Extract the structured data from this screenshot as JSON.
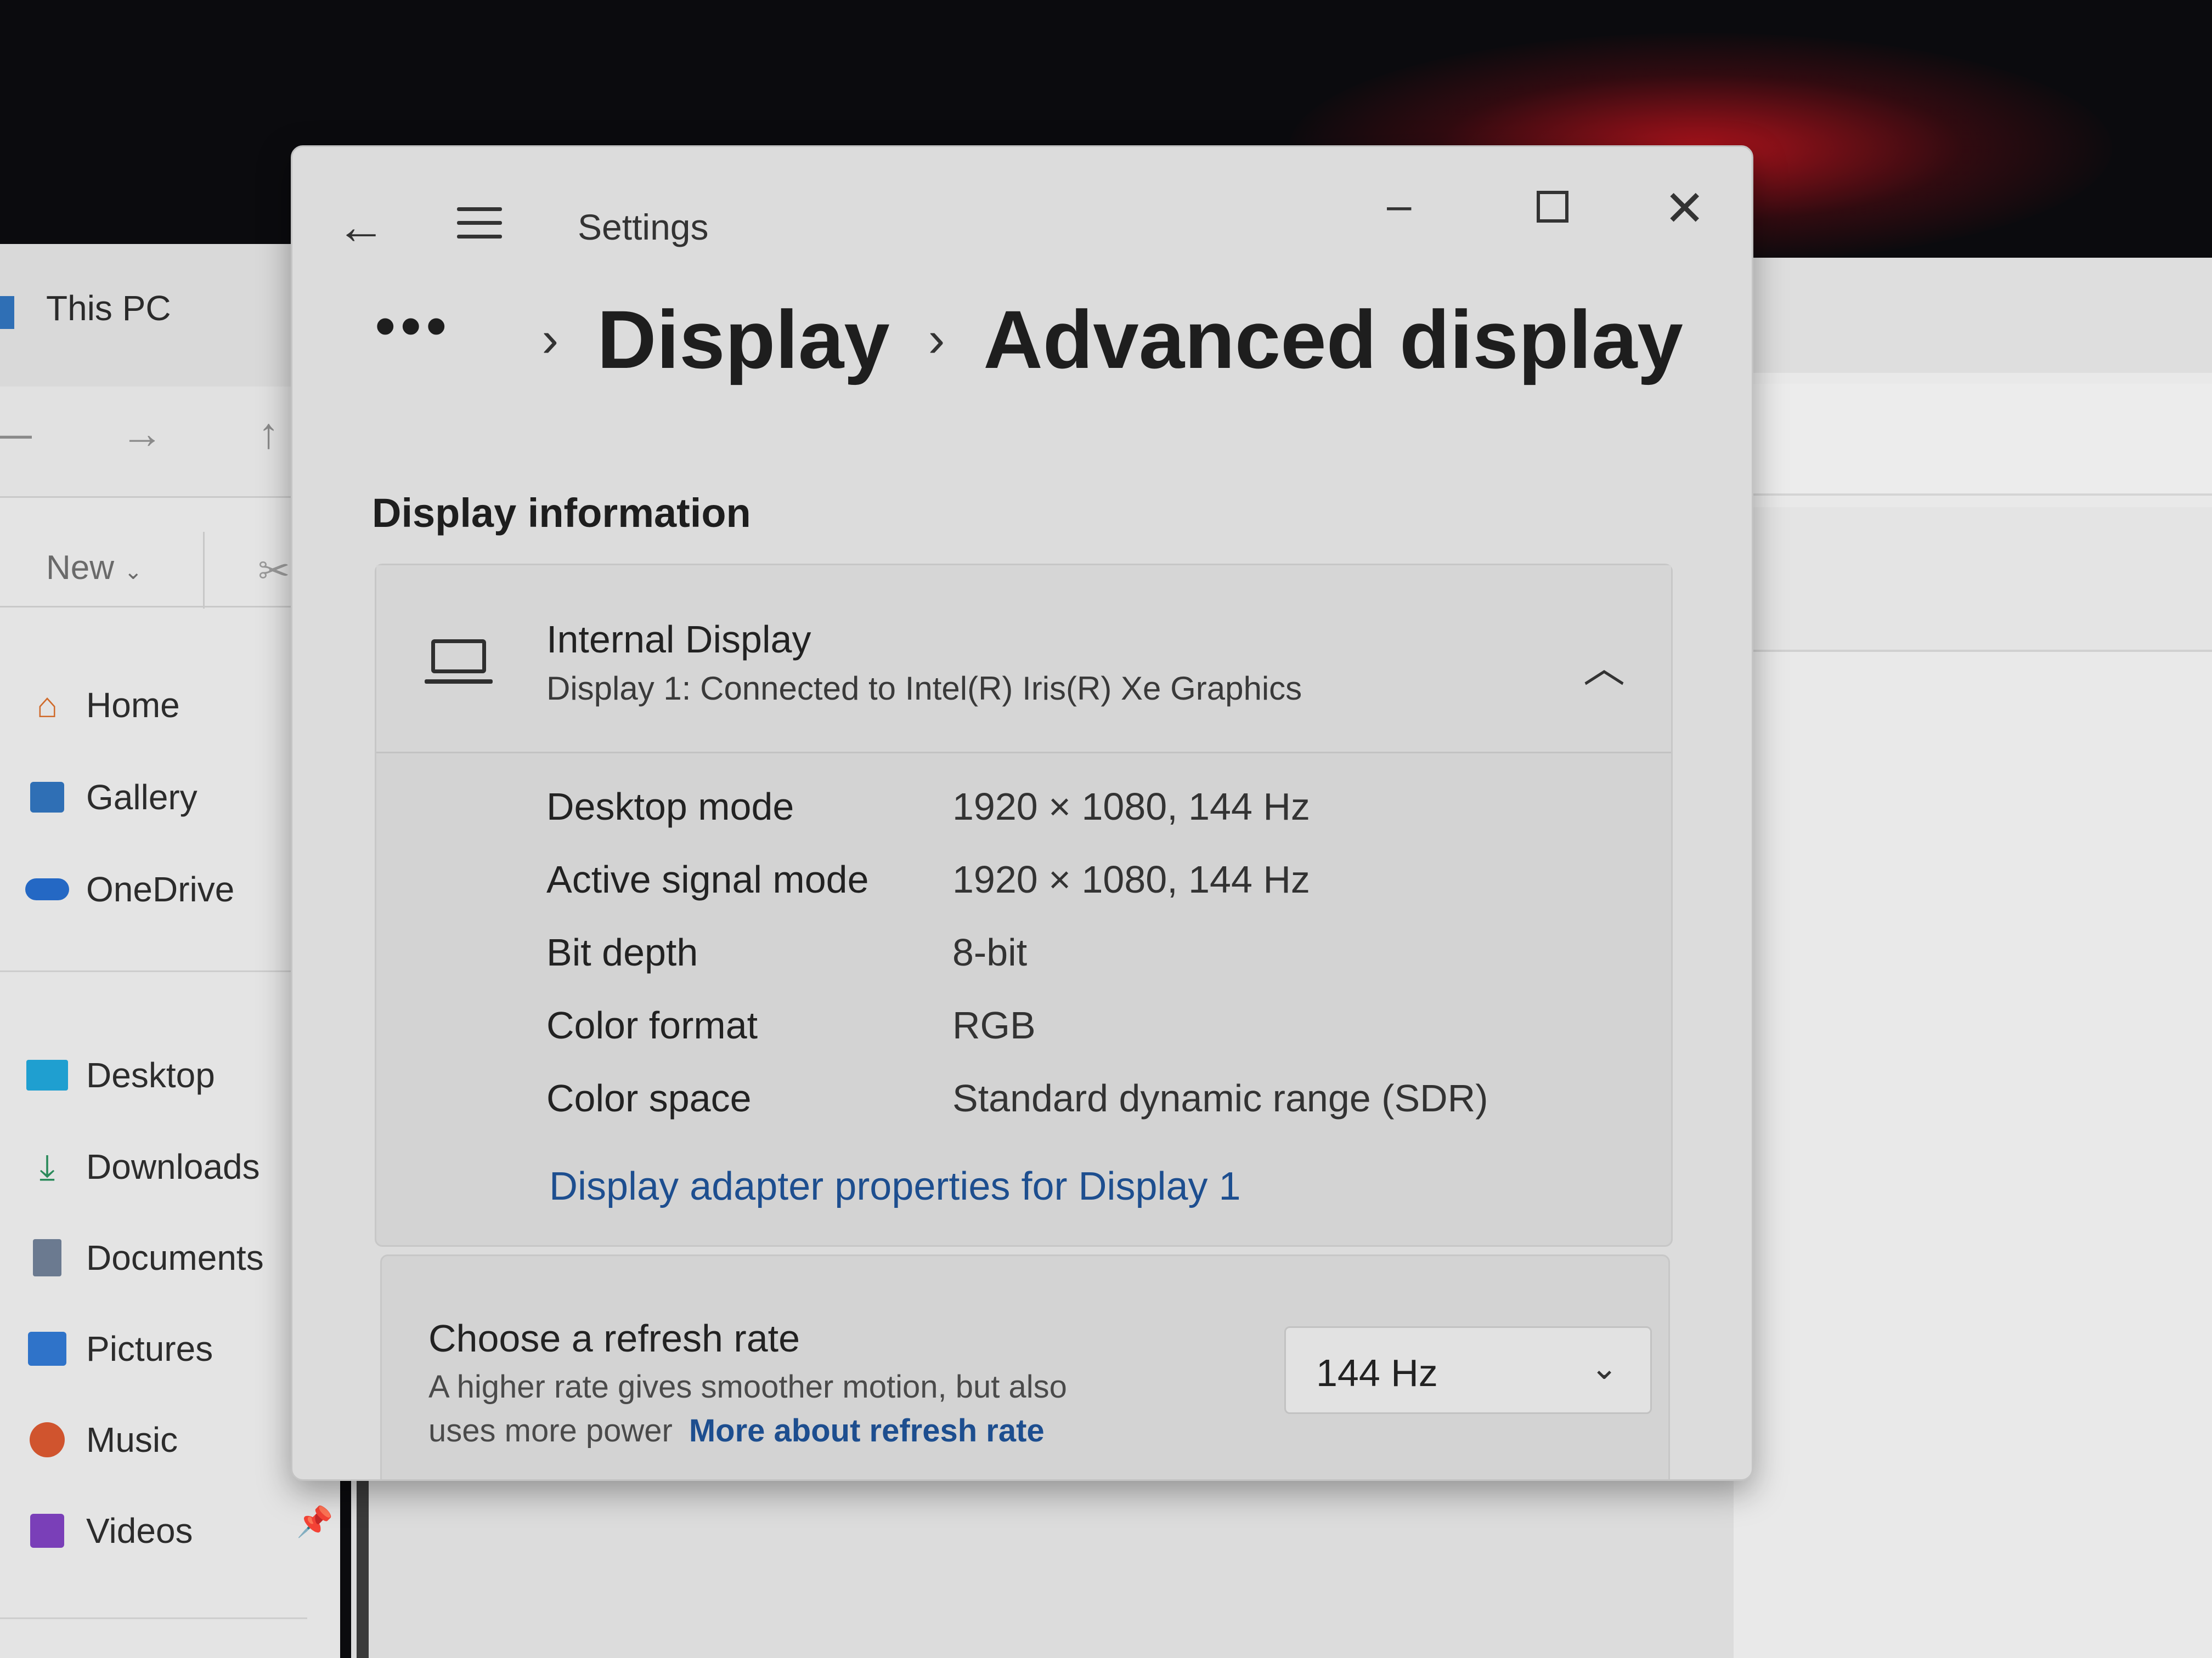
{
  "explorer": {
    "title": "This PC",
    "new_label": "New",
    "nav": [
      {
        "label": "Home"
      },
      {
        "label": "Gallery"
      },
      {
        "label": "OneDrive"
      },
      {
        "label": "Desktop"
      },
      {
        "label": "Downloads"
      },
      {
        "label": "Documents"
      },
      {
        "label": "Pictures"
      },
      {
        "label": "Music"
      },
      {
        "label": "Videos"
      }
    ]
  },
  "settings": {
    "app_title": "Settings",
    "breadcrumb": {
      "more": "•••",
      "parent": "Display",
      "current": "Advanced display"
    },
    "section_title": "Display information",
    "display": {
      "name": "Internal Display",
      "subtitle": "Display 1: Connected to Intel(R) Iris(R) Xe Graphics",
      "rows": [
        {
          "label": "Desktop mode",
          "value": "1920 × 1080, 144 Hz"
        },
        {
          "label": "Active signal mode",
          "value": "1920 × 1080, 144 Hz"
        },
        {
          "label": "Bit depth",
          "value": "8-bit"
        },
        {
          "label": "Color format",
          "value": "RGB"
        },
        {
          "label": "Color space",
          "value": "Standard dynamic range (SDR)"
        }
      ],
      "adapter_link": "Display adapter properties for Display 1"
    },
    "refresh": {
      "title": "Choose a refresh rate",
      "desc_line1": "A higher rate gives smoother motion, but also",
      "desc_line2": "uses more power",
      "link": "More about refresh rate",
      "selected": "144 Hz"
    }
  }
}
